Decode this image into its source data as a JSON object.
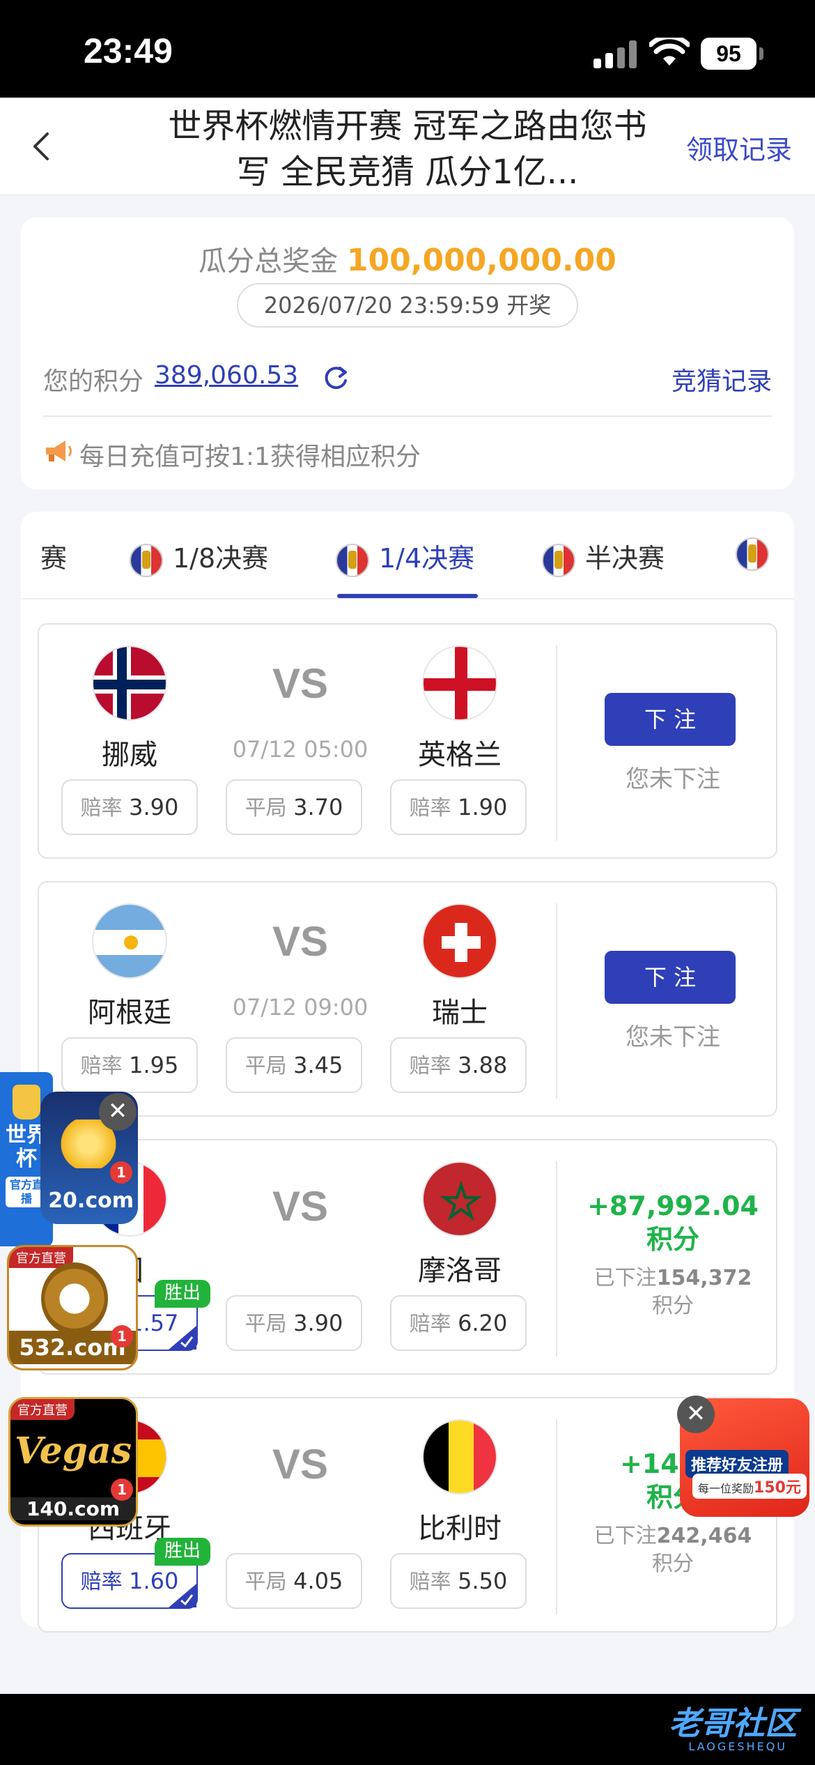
{
  "status": {
    "time": "23:49",
    "battery": "95"
  },
  "nav": {
    "title": "世界杯燃情开赛 冠军之路由您书写 全民竞猜 瓜分1亿...",
    "right": "领取记录"
  },
  "pool": {
    "label": "瓜分总奖金",
    "amount": "100,000,000.00",
    "draw_time": "2026/07/20 23:59:59 开奖",
    "points_label": "您的积分",
    "points_value": "389,060.53",
    "bet_record": "竞猜记录",
    "notice": "每日充值可按1:1获得相应积分"
  },
  "tabs": [
    {
      "label": "赛"
    },
    {
      "label": "1/8决赛"
    },
    {
      "label": "1/4决赛",
      "active": true
    },
    {
      "label": "半决赛"
    },
    {
      "label": ""
    }
  ],
  "matches": [
    {
      "home": "挪威",
      "away": "英格兰",
      "time": "07/12 05:00",
      "vs": "VS",
      "odds": {
        "home_label": "赔率",
        "home": "3.90",
        "draw_label": "平局",
        "draw": "3.70",
        "away_label": "赔率",
        "away": "1.90"
      },
      "button": "下 注",
      "state": "您未下注"
    },
    {
      "home": "阿根廷",
      "away": "瑞士",
      "time": "07/12 09:00",
      "vs": "VS",
      "odds": {
        "home_label": "赔率",
        "home": "1.95",
        "draw_label": "平局",
        "draw": "3.45",
        "away_label": "赔率",
        "away": "3.88"
      },
      "button": "下 注",
      "state": "您未下注"
    },
    {
      "home": "国",
      "away": "摩洛哥",
      "vs": "VS",
      "odds": {
        "home_label": "赔率",
        "home": "1.57",
        "draw_label": "平局",
        "draw": "3.90",
        "away_label": "赔率",
        "away": "6.20"
      },
      "win_badge": "胜出",
      "gain": "+87,992.04",
      "gain_unit": "积分",
      "staked_label": "已下注",
      "staked": "154,372",
      "staked_unit": "积分"
    },
    {
      "home": "西班牙",
      "away": "比利时",
      "vs": "VS",
      "odds": {
        "home_label": "赔率",
        "home": "1.60",
        "draw_label": "平局",
        "draw": "4.05",
        "away_label": "赔率",
        "away": "5.50"
      },
      "win_badge": "胜出",
      "gain": "+145,4",
      "gain_unit": "积分",
      "staked_label": "已下注",
      "staked": "242,464",
      "staked_unit": "积分"
    }
  ],
  "floats": {
    "wc_title": "世界杯",
    "wc_sub": "官方直播",
    "ad_a": "20.com",
    "ad_b": "532.com",
    "ad_c_logo": "Vegas",
    "ad_c": "140.com",
    "official": "官方直营",
    "badge": "1",
    "close": "✕",
    "refer_title": "推荐好友注册",
    "refer_sub_prefix": "每一位奖励",
    "refer_sub_value": "150元"
  },
  "watermark": {
    "main": "老哥社区",
    "sub": "LAOGESHEQU"
  },
  "colors": {
    "accent": "#2f3fb8",
    "gold": "#f5a623",
    "win": "#22b33a"
  }
}
